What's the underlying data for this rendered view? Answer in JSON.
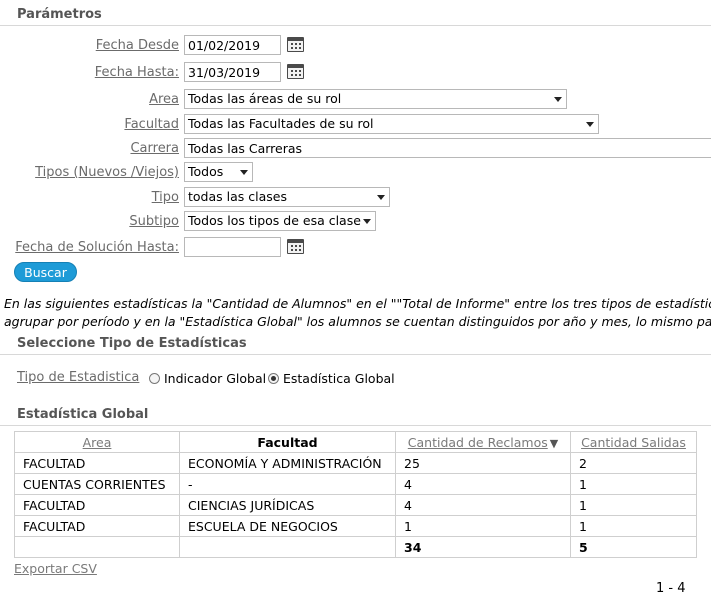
{
  "parametros": {
    "title": "Parámetros",
    "fecha_desde": {
      "label": "Fecha Desde",
      "value": "01/02/2019"
    },
    "fecha_hasta": {
      "label": "Fecha Hasta:",
      "value": "31/03/2019"
    },
    "area": {
      "label": "Area",
      "value": "Todas las áreas de su rol"
    },
    "facultad": {
      "label": "Facultad",
      "value": "Todas las Facultades de su rol"
    },
    "carrera": {
      "label": "Carrera",
      "value": "Todas las Carreras"
    },
    "tipos": {
      "label": "Tipos (Nuevos /Viejos)",
      "value": "Todos"
    },
    "tipo": {
      "label": "Tipo",
      "value": "todas las clases"
    },
    "subtipo": {
      "label": "Subtipo",
      "value": "Todos los tipos de esa clase"
    },
    "fecha_solucion": {
      "label": "Fecha de Solución Hasta:",
      "value": ""
    },
    "buscar_label": "Buscar"
  },
  "info_text": {
    "line1": "En las siguientes estadísticas la \"Cantidad de Alumnos\" en el \"\"Total de Informe\" entre los tres tipos de estadísticas diferi",
    "line2": "agrupar por período y en la \"Estadística Global\" los alumnos se cuentan distinguidos por año y mes, lo mismo pasa con la"
  },
  "tipo_estadisticas": {
    "title": "Seleccione Tipo de Estadísticas",
    "label": "Tipo de Estadistica",
    "options": [
      {
        "label": "Indicador Global",
        "selected": false
      },
      {
        "label": "Estadística Global",
        "selected": true
      }
    ]
  },
  "estadistica_global": {
    "title": "Estadística Global",
    "columns": [
      "Area",
      "Facultad",
      "Cantidad de Reclamos",
      "Cantidad Salidas"
    ],
    "rows": [
      [
        "FACULTAD",
        "ECONOMÍA Y ADMINISTRACIÓN",
        "25",
        "2"
      ],
      [
        "CUENTAS CORRIENTES",
        "-",
        "4",
        "1"
      ],
      [
        "FACULTAD",
        "CIENCIAS JURÍDICAS",
        "4",
        "1"
      ],
      [
        "FACULTAD",
        "ESCUELA DE NEGOCIOS",
        "1",
        "1"
      ]
    ],
    "totals": [
      "",
      "",
      "34",
      "5"
    ],
    "sort_arrow": "▼"
  },
  "export_label": "Exportar CSV",
  "pager": "1 - 4"
}
